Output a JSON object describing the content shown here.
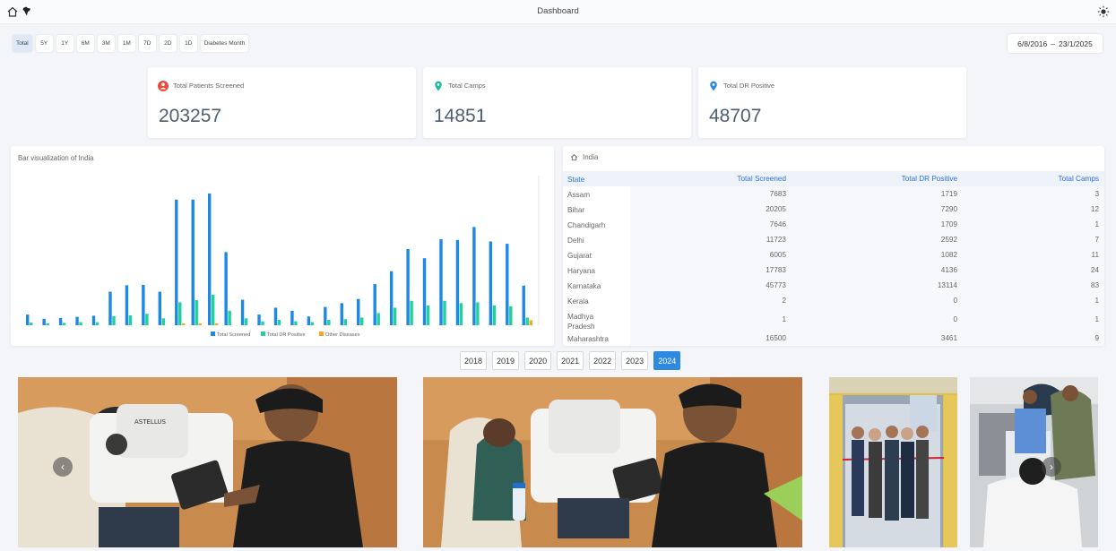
{
  "header": {
    "title": "Dashboard"
  },
  "ranges": [
    {
      "label": "Total",
      "active": true
    },
    {
      "label": "5Y"
    },
    {
      "label": "1Y"
    },
    {
      "label": "6M"
    },
    {
      "label": "3M"
    },
    {
      "label": "1M"
    },
    {
      "label": "7D"
    },
    {
      "label": "2D"
    },
    {
      "label": "1D"
    },
    {
      "label": "Diabetes Month"
    }
  ],
  "date_range": {
    "start": "6/8/2016",
    "end": "23/1/2025"
  },
  "stats": [
    {
      "label": "Total Patients Screened",
      "value": "203257",
      "icon": "patient-icon",
      "color": "#e74c3c"
    },
    {
      "label": "Total Camps",
      "value": "14851",
      "icon": "location-pin-icon",
      "color": "#1abc9c"
    },
    {
      "label": "Total DR Positive",
      "value": "48707",
      "icon": "location-pin-icon",
      "color": "#2d8ae0"
    }
  ],
  "chart": {
    "title": "Bar visualization of India"
  },
  "chart_data": {
    "type": "bar",
    "series": [
      {
        "name": "Total Screened",
        "color": "#1e88e5",
        "values": [
          1400,
          850,
          950,
          1100,
          1250,
          4400,
          5250,
          5300,
          4400,
          16500,
          16500,
          17300,
          9600,
          3350,
          1400,
          2300,
          1900,
          1150,
          2400,
          2900,
          3450,
          5400,
          7100,
          10000,
          8800,
          11300,
          11200,
          12900,
          11000,
          10700,
          5200
        ]
      },
      {
        "name": "Total DR Positive",
        "color": "#1fd19a",
        "values": [
          350,
          250,
          300,
          400,
          400,
          1200,
          1300,
          1500,
          900,
          3000,
          3300,
          4000,
          1900,
          900,
          500,
          700,
          500,
          400,
          700,
          800,
          1000,
          1600,
          2300,
          3200,
          2600,
          3200,
          2900,
          3000,
          2600,
          2500,
          1000
        ]
      },
      {
        "name": "Other Diseases",
        "color": "#f5a623",
        "values": [
          0,
          0,
          0,
          0,
          0,
          0,
          0,
          0,
          0,
          250,
          250,
          250,
          0,
          0,
          0,
          0,
          0,
          0,
          0,
          0,
          0,
          0,
          0,
          0,
          0,
          0,
          0,
          0,
          0,
          0,
          650
        ]
      }
    ],
    "ylim": [
      0,
      20000
    ],
    "legend": "bottom-center"
  },
  "region": {
    "title": "India"
  },
  "table": {
    "headers": [
      "State",
      "Total Screened",
      "Total DR Positive",
      "Total Camps"
    ],
    "rows": [
      {
        "state": "Assam",
        "screened": "7683",
        "dr": "1719",
        "camps": "3"
      },
      {
        "state": "Bihar",
        "screened": "20205",
        "dr": "7290",
        "camps": "12"
      },
      {
        "state": "Chandigarh",
        "screened": "7646",
        "dr": "1709",
        "camps": "1"
      },
      {
        "state": "Delhi",
        "screened": "11723",
        "dr": "2592",
        "camps": "7"
      },
      {
        "state": "Gujarat",
        "screened": "6005",
        "dr": "1082",
        "camps": "11"
      },
      {
        "state": "Haryana",
        "screened": "17783",
        "dr": "4136",
        "camps": "24"
      },
      {
        "state": "Karnataka",
        "screened": "45773",
        "dr": "13114",
        "camps": "83"
      },
      {
        "state": "Kerala",
        "screened": "2",
        "dr": "0",
        "camps": "1"
      },
      {
        "state": "Madhya Pradesh",
        "screened": "1",
        "dr": "0",
        "camps": "1"
      },
      {
        "state": "Maharashtra",
        "screened": "16500",
        "dr": "3461",
        "camps": "9"
      }
    ]
  },
  "years": [
    {
      "label": "2018"
    },
    {
      "label": "2019"
    },
    {
      "label": "2020"
    },
    {
      "label": "2021"
    },
    {
      "label": "2022"
    },
    {
      "label": "2023"
    },
    {
      "label": "2024",
      "active": true
    }
  ],
  "photos": {
    "brand_text": "ASTELLUS",
    "prev_icon": "chevron-left-icon",
    "next_icon": "chevron-right-icon"
  }
}
